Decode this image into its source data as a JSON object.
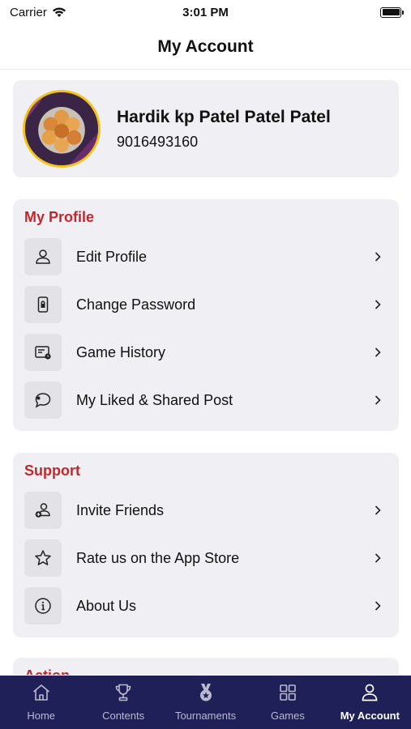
{
  "status_bar": {
    "carrier": "Carrier",
    "time": "3:01 PM"
  },
  "header": {
    "title": "My Account"
  },
  "profile": {
    "name": "Hardik kp Patel Patel Patel",
    "phone": "9016493160"
  },
  "my_profile": {
    "title": "My Profile",
    "items": [
      {
        "label": "Edit Profile",
        "icon": "person-icon"
      },
      {
        "label": "Change Password",
        "icon": "lock-phone-icon"
      },
      {
        "label": "Game History",
        "icon": "history-icon"
      },
      {
        "label": "My Liked & Shared Post",
        "icon": "chat-bubble-icon"
      }
    ]
  },
  "support": {
    "title": "Support",
    "items": [
      {
        "label": "Invite Friends",
        "icon": "add-user-icon"
      },
      {
        "label": "Rate us on the App Store",
        "icon": "star-icon"
      },
      {
        "label": "About Us",
        "icon": "info-icon"
      }
    ]
  },
  "action": {
    "title": "Action"
  },
  "tab_bar": {
    "tabs": [
      {
        "label": "Home",
        "icon": "home-icon"
      },
      {
        "label": "Contents",
        "icon": "trophy-icon"
      },
      {
        "label": "Tournaments",
        "icon": "medal-icon"
      },
      {
        "label": "Games",
        "icon": "grid-icon"
      },
      {
        "label": "My Account",
        "icon": "account-icon"
      }
    ],
    "active": "My Account"
  },
  "colors": {
    "accent": "#c0282d",
    "tab_bar": "#1f2057",
    "card": "#efeff4",
    "avatar_ring": "#f3c316"
  }
}
